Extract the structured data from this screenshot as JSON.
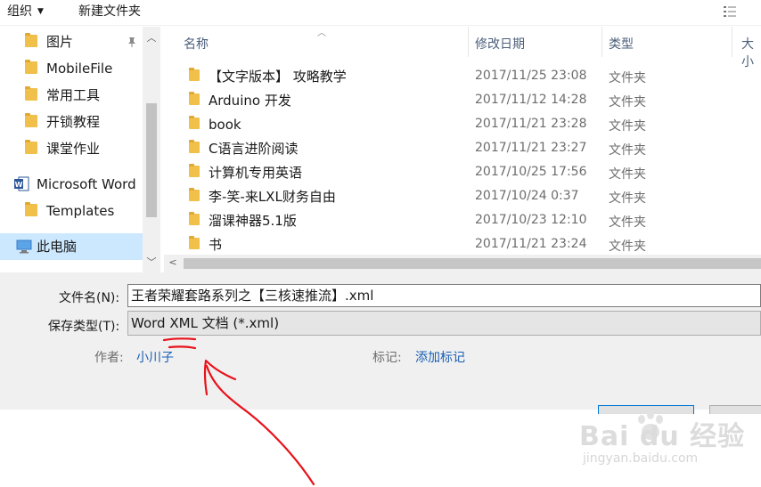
{
  "toolbar": {
    "organize": "组织",
    "new_folder": "新建文件夹"
  },
  "nav": {
    "items": [
      {
        "label": "图片",
        "icon": "folder-pictures-icon"
      },
      {
        "label": "MobileFile",
        "icon": "folder-icon"
      },
      {
        "label": "常用工具",
        "icon": "folder-icon"
      },
      {
        "label": "开锁教程",
        "icon": "folder-icon"
      },
      {
        "label": "课堂作业",
        "icon": "folder-icon"
      },
      {
        "label": "Microsoft Word",
        "icon": "word-icon"
      },
      {
        "label": "Templates",
        "icon": "folder-icon"
      },
      {
        "label": "此电脑",
        "icon": "computer-icon"
      }
    ]
  },
  "columns": {
    "name": "名称",
    "modified": "修改日期",
    "type": "类型",
    "size": "大小"
  },
  "files": [
    {
      "name": "【文字版本】 攻略教学",
      "date": "2017/11/25 23:08",
      "type": "文件夹"
    },
    {
      "name": "Arduino 开发",
      "date": "2017/11/12 14:28",
      "type": "文件夹"
    },
    {
      "name": "book",
      "date": "2017/11/21 23:28",
      "type": "文件夹"
    },
    {
      "name": "C语言进阶阅读",
      "date": "2017/11/21 23:27",
      "type": "文件夹"
    },
    {
      "name": "计算机专用英语",
      "date": "2017/10/25 17:56",
      "type": "文件夹"
    },
    {
      "name": "李-笑-来LXL财务自由",
      "date": "2017/10/24 0:37",
      "type": "文件夹"
    },
    {
      "name": "溜课神器5.1版",
      "date": "2017/10/23 12:10",
      "type": "文件夹"
    },
    {
      "name": "书",
      "date": "2017/11/21 23:24",
      "type": "文件夹"
    }
  ],
  "form": {
    "filename_label": "文件名(N):",
    "filename_value": "王者荣耀套路系列之【三核速推流】.xml",
    "savetype_label": "保存类型(T):",
    "savetype_value": "Word XML 文档 (*.xml)",
    "author_label": "作者:",
    "author_value": "小川子",
    "tags_label": "标记:",
    "tags_value": "添加标记"
  },
  "watermark": {
    "logo": "Bai du 经验",
    "url": "jingyan.baidu.com"
  },
  "colors": {
    "annotation_red": "#e8121b",
    "link_blue": "#1a5fb4",
    "folder_yellow": "#f0c04a",
    "selected_bg": "#cce8ff"
  }
}
